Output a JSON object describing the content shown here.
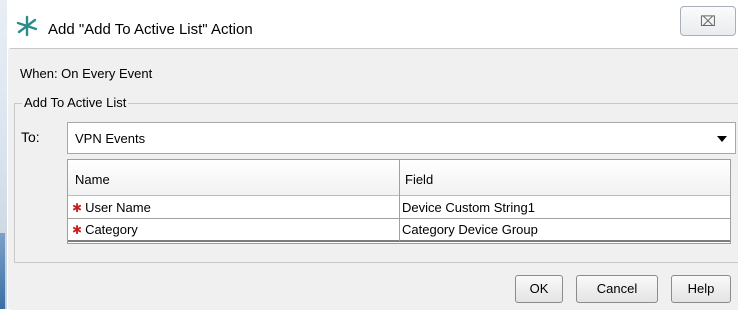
{
  "dialog": {
    "title": "Add \"Add To Active List\" Action",
    "close_label": "⌧"
  },
  "when": {
    "label": "When: On Every Event"
  },
  "group": {
    "title": "Add To Active List"
  },
  "to": {
    "label": "To:",
    "selected": "VPN Events"
  },
  "table": {
    "columns": [
      "Name",
      "Field"
    ],
    "required_marker": "✱",
    "rows": [
      {
        "name": "User Name",
        "field": "Device Custom String1"
      },
      {
        "name": "Category",
        "field": "Category Device Group"
      }
    ]
  },
  "buttons": {
    "ok": "OK",
    "cancel": "Cancel",
    "help": "Help"
  },
  "colors": {
    "required": "#cc1f1f",
    "icon": "#2e8b8b"
  },
  "icons": {
    "title": "action-star-icon",
    "dropdown": "chevron-down-icon"
  }
}
